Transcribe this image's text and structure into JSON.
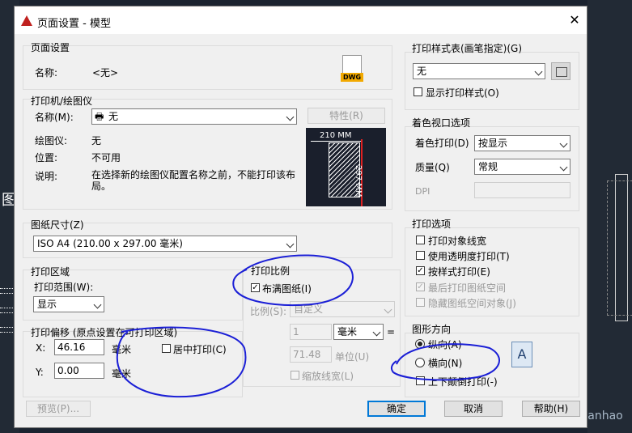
{
  "window": {
    "title": "页面设置 - 模型",
    "close_glyph": "✕"
  },
  "page_setup": {
    "group_title": "页面设置",
    "name_label": "名称:",
    "name_value": "<无>"
  },
  "plotter": {
    "group_title": "打印机/绘图仪",
    "name_label": "名称(M):",
    "name_value": "无",
    "properties_button": "特性(R)",
    "plotter_label": "绘图仪:",
    "plotter_value": "无",
    "location_label": "位置:",
    "location_value": "不可用",
    "description_label": "说明:",
    "description_value": "在选择新的绘图仪配置名称之前，不能打印该布局。",
    "preview_width": "210 MM",
    "preview_height": "297 MM"
  },
  "paper_size": {
    "group_title": "图纸尺寸(Z)",
    "value": "ISO A4 (210.00 x 297.00 毫米)"
  },
  "plot_area": {
    "group_title": "打印区域",
    "range_label": "打印范围(W):",
    "range_value": "显示"
  },
  "plot_offset": {
    "group_title": "打印偏移 (原点设置在可打印区域)",
    "x_label": "X:",
    "x_value": "46.16",
    "x_unit": "毫米",
    "y_label": "Y:",
    "y_value": "0.00",
    "y_unit": "毫米",
    "center_label": "居中打印(C)"
  },
  "plot_scale": {
    "group_title": "打印比例",
    "fit_label": "布满图纸(I)",
    "scale_label": "比例(S):",
    "scale_value": "自定义",
    "num_value": "1",
    "unit_value": "毫米",
    "equals": "=",
    "den_value": "71.48",
    "den_unit": "单位(U)",
    "lineweight_label": "缩放线宽(L)"
  },
  "plot_style_table": {
    "group_title": "打印样式表(画笔指定)(G)",
    "value": "无",
    "show_label": "显示打印样式(O)"
  },
  "shaded_viewport": {
    "group_title": "着色视口选项",
    "shade_label": "着色打印(D)",
    "shade_value": "按显示",
    "quality_label": "质量(Q)",
    "quality_value": "常规",
    "dpi_label": "DPI"
  },
  "plot_options": {
    "group_title": "打印选项",
    "items": [
      {
        "label": "打印对象线宽",
        "checked": ""
      },
      {
        "label": "使用透明度打印(T)",
        "checked": ""
      },
      {
        "label": "按样式打印(E)",
        "checked": "✓"
      },
      {
        "label": "最后打印图纸空间",
        "checked": "✓"
      },
      {
        "label": "隐藏图纸空间对象(J)",
        "checked": ""
      }
    ]
  },
  "orientation": {
    "group_title": "图形方向",
    "portrait_label": "纵向(A)",
    "landscape_label": "横向(N)",
    "upside_down_label": "上下颠倒打印(-)",
    "icon_letter": "A"
  },
  "footer": {
    "preview_button": "预览(P)...",
    "ok_button": "确定",
    "cancel_button": "取消",
    "help_button": "帮助(H)"
  },
  "background": {
    "glyph": "图",
    "watermark": "https://blog.csdn.net/zengjianhao"
  },
  "colors": {
    "annotation": "#1b1fd6",
    "accent": "#0078d7"
  }
}
